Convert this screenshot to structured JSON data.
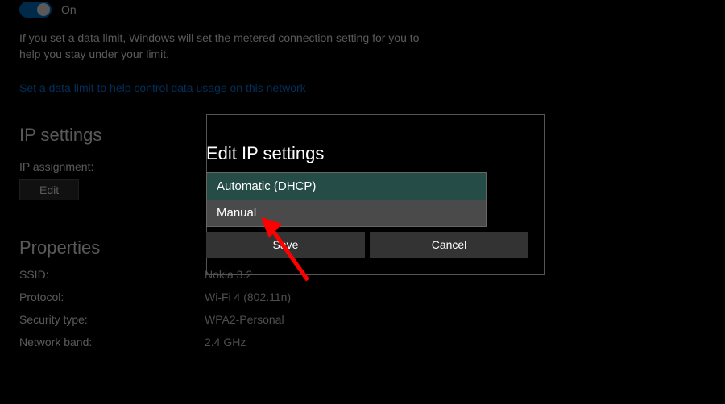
{
  "toggle": {
    "label": "On"
  },
  "dataLimit": {
    "desc": "If you set a data limit, Windows will set the metered connection setting for you to help you stay under your limit.",
    "link": "Set a data limit to help control data usage on this network"
  },
  "ipSettings": {
    "heading": "IP settings",
    "assignmentLabel": "IP assignment:",
    "editButton": "Edit"
  },
  "properties": {
    "heading": "Properties",
    "rows": [
      {
        "label": "SSID:",
        "value": "Nokia 3.2"
      },
      {
        "label": "Protocol:",
        "value": "Wi-Fi 4 (802.11n)"
      },
      {
        "label": "Security type:",
        "value": "WPA2-Personal"
      },
      {
        "label": "Network band:",
        "value": "2.4 GHz"
      }
    ]
  },
  "dialog": {
    "title": "Edit IP settings",
    "options": [
      {
        "label": "Automatic (DHCP)"
      },
      {
        "label": "Manual"
      }
    ],
    "save": "Save",
    "cancel": "Cancel"
  }
}
